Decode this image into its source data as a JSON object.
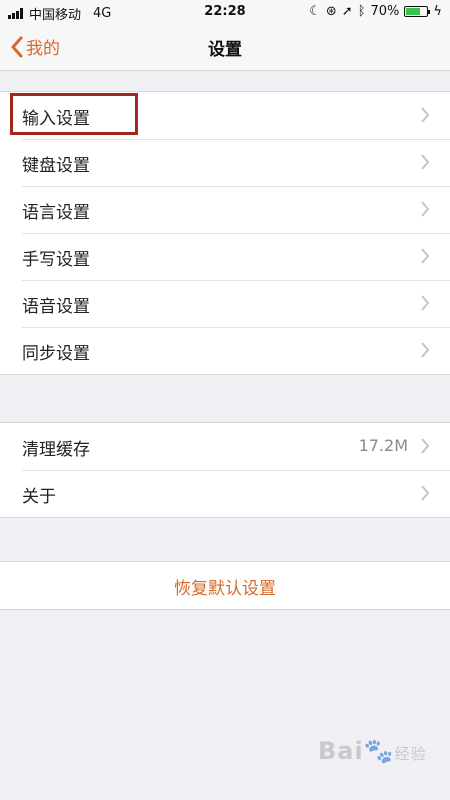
{
  "status_bar": {
    "carrier": "中国移动",
    "network": "4G",
    "time": "22:28",
    "battery_percent": "70%",
    "battery_level": 0.7,
    "battery_color": "#3ac34a"
  },
  "nav": {
    "back_label": "我的",
    "title": "设置"
  },
  "group1": {
    "items": [
      {
        "label": "输入设置"
      },
      {
        "label": "键盘设置"
      },
      {
        "label": "语言设置"
      },
      {
        "label": "手写设置"
      },
      {
        "label": "语音设置"
      },
      {
        "label": "同步设置"
      }
    ]
  },
  "group2": {
    "items": [
      {
        "label": "清理缓存",
        "value": "17.2M"
      },
      {
        "label": "关于"
      }
    ]
  },
  "reset": {
    "label": "恢复默认设置"
  },
  "colors": {
    "accent": "#d9692b",
    "highlight": "#a5261d",
    "background": "#efeff4"
  },
  "watermark": {
    "text": "Bai",
    "text2": "经验"
  }
}
